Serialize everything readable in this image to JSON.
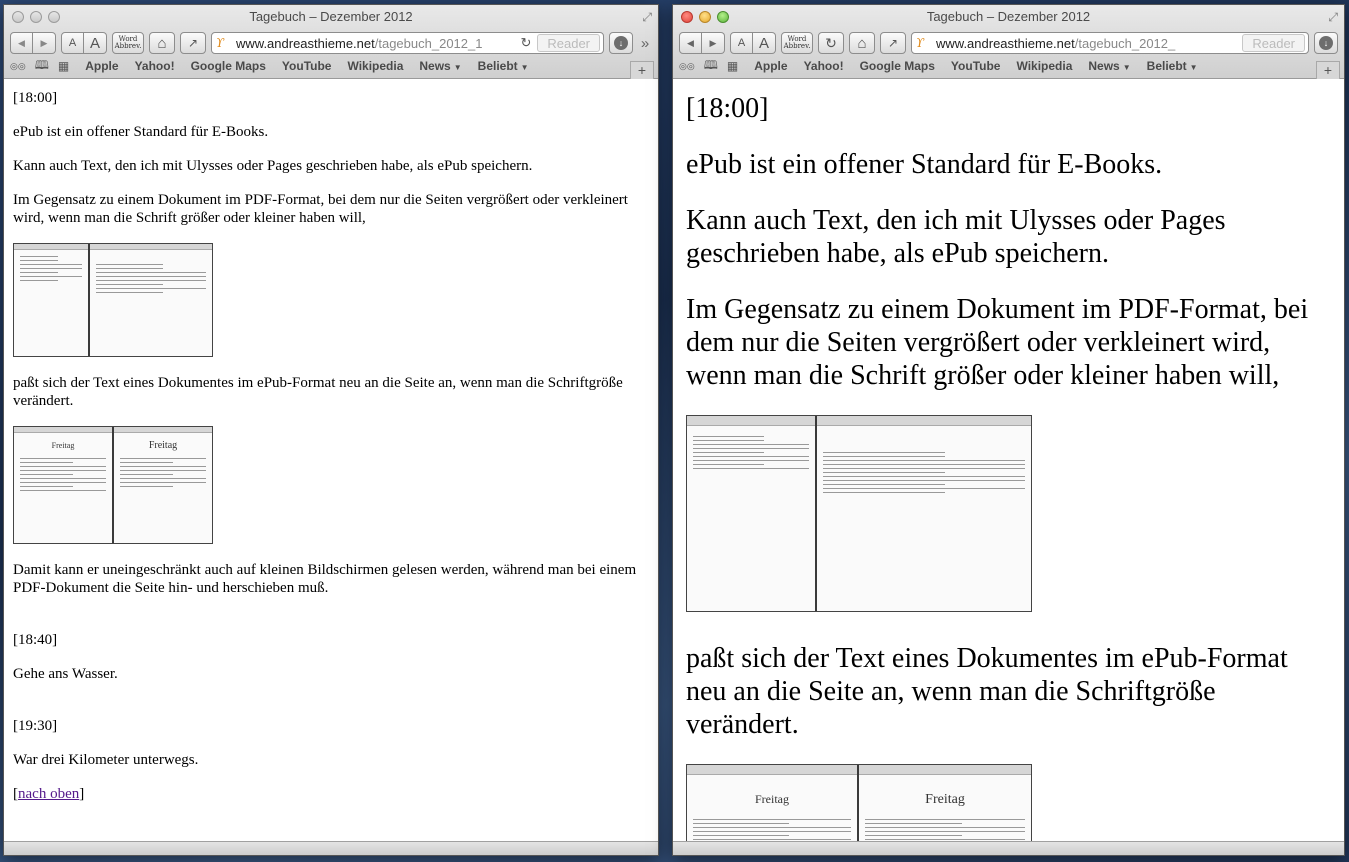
{
  "windows": [
    {
      "id": "left",
      "title": "Tagebuch – Dezember 2012",
      "toolbar": {
        "text_smaller": "A",
        "text_larger": "A",
        "word_button": "Word\nAbbrev.",
        "url_host": "www.andreasthieme.net",
        "url_path": "/tagebuch_2012_1",
        "reader": "Reader"
      },
      "bookmarks": [
        "Apple",
        "Yahoo!",
        "Google Maps",
        "YouTube",
        "Wikipedia",
        "News",
        "Beliebt"
      ],
      "content": {
        "t1": "[18:00]",
        "p1": "ePub ist ein offener Standard für E-Books.",
        "p2": "Kann auch Text, den ich mit Ulysses oder Pages geschrieben habe, als ePub speichern.",
        "p3": "Im Gegensatz zu einem Dokument im PDF-Format, bei dem nur die Seiten vergrößert oder verkleinert wird, wenn man die Schrift größer oder kleiner haben will,",
        "p4": "paßt sich der Text eines Dokumentes im ePub-Format neu an die Seite an, wenn man die Schriftgröße verändert.",
        "thumb2_heading": "Freitag",
        "p5": "Damit kann er uneingeschränkt auch auf kleinen Bildschirmen gelesen werden, während man bei einem PDF-Dokument die Seite hin- und herschieben muß.",
        "t2": "[18:40]",
        "p6": "Gehe ans Wasser.",
        "t3": "[19:30]",
        "p7": "War drei Kilometer unterwegs.",
        "bracket_open": "[",
        "link": "nach oben",
        "bracket_close": "]"
      }
    },
    {
      "id": "right",
      "title": "Tagebuch – Dezember 2012",
      "toolbar": {
        "text_smaller": "A",
        "text_larger": "A",
        "word_button": "Word\nAbbrev.",
        "url_host": "www.andreasthieme.net",
        "url_path": "/tagebuch_2012_",
        "reader": "Reader"
      },
      "bookmarks": [
        "Apple",
        "Yahoo!",
        "Google Maps",
        "YouTube",
        "Wikipedia",
        "News",
        "Beliebt"
      ],
      "content": {
        "t1": "[18:00]",
        "p1": "ePub ist ein offener Standard für E-Books.",
        "p2": "Kann auch Text, den ich mit Ulysses oder Pages geschrieben habe, als ePub speichern.",
        "p3": "Im Gegensatz zu einem Dokument im PDF-Format, bei dem nur die Seiten vergrößert oder verkleinert wird, wenn man die Schrift größer oder kleiner haben will,",
        "p4": "paßt sich der Text eines Dokumentes im ePub-Format neu an die Seite an, wenn man die Schriftgröße verändert.",
        "thumb2_heading": "Freitag"
      }
    }
  ],
  "icons": {
    "back": "◀",
    "forward": "▶",
    "home": "⌂",
    "share": "↗",
    "reload": "↻",
    "download": "↓",
    "overflow": "»",
    "reading_list": "◎◎",
    "bookmarks_book": "📖",
    "top_sites": "▦",
    "new_tab": "+",
    "resize": "⤢",
    "menu_caret": "▼"
  },
  "colors": {
    "link": "#551a8b",
    "favicon": "#e08a1a"
  }
}
